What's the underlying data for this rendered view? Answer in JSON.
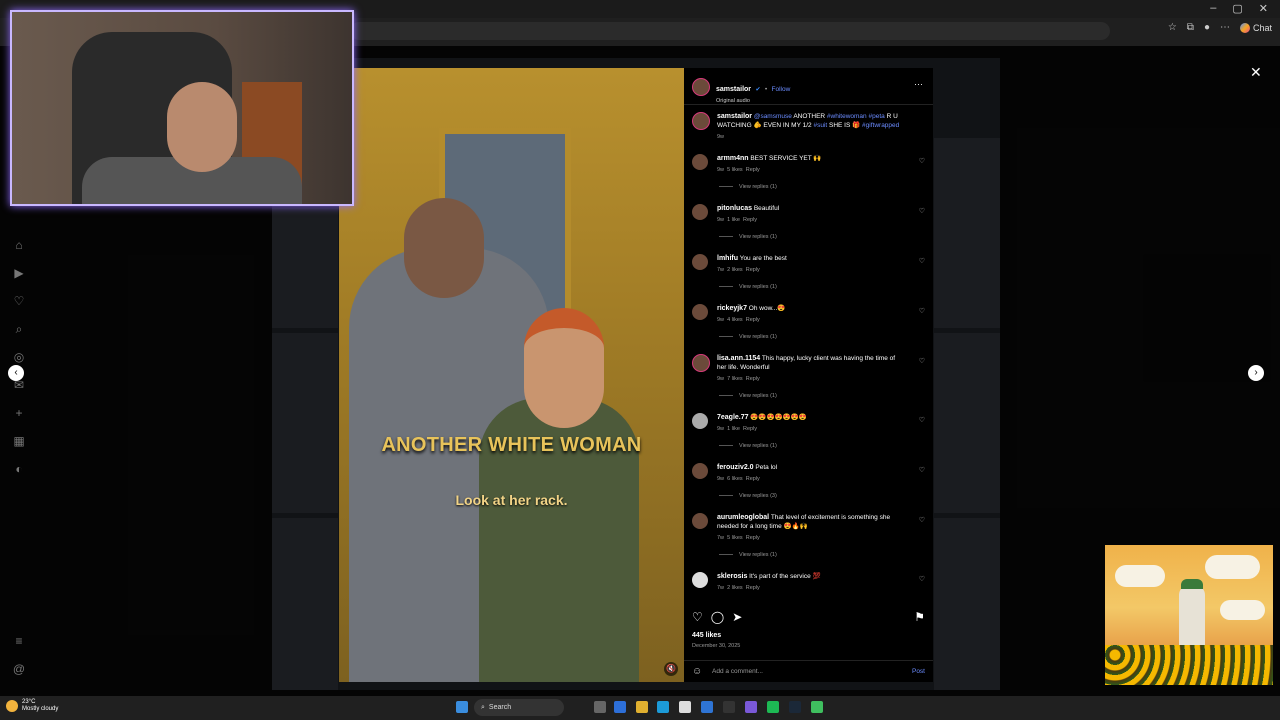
{
  "browser": {
    "chat_label": "Chat",
    "window_controls": [
      "–",
      "▢",
      "✕"
    ]
  },
  "sidebar_icons": [
    "home-icon",
    "reels-icon",
    "heart-icon",
    "search-icon",
    "explore-icon",
    "messages-icon",
    "add-icon",
    "dashboard-icon",
    "profile-icon",
    "menu-icon",
    "threads-icon"
  ],
  "video": {
    "caption_main": "ANOTHER WHITE WOMAN",
    "caption_sub": "Look at her rack."
  },
  "post": {
    "username": "samstailor",
    "follow_label": "Follow",
    "bullet": "•",
    "audio": "Original audio",
    "more_icon": "···",
    "caption": {
      "username": "samstailor",
      "mention": "@samsmuse",
      "text1": "ANOTHER",
      "tag1": "#whitewoman",
      "tag2": "#peta",
      "text2": "R U WATCHING 🫵 EVEN IN MY 1/2",
      "tag3": "#suit",
      "text3": "SHE IS 🎁",
      "tag4": "#giftwrapped",
      "time": "9w"
    },
    "comments": [
      {
        "user": "armm4nn",
        "text": "BEST SERVICE YET 🙌",
        "time": "9w",
        "likes": "5 likes",
        "reply": "Reply",
        "view": "View replies (1)"
      },
      {
        "user": "pitonlucas",
        "text": "Beautiful",
        "time": "9w",
        "likes": "1 like",
        "reply": "Reply",
        "view": "View replies (1)"
      },
      {
        "user": "lmhifu",
        "text": "You are the best",
        "time": "7w",
        "likes": "2 likes",
        "reply": "Reply",
        "view": "View replies (1)"
      },
      {
        "user": "rickeyjk7",
        "text": "Oh wow...😍",
        "time": "9w",
        "likes": "4 likes",
        "reply": "Reply",
        "view": "View replies (1)"
      },
      {
        "user": "lisa.ann.1154",
        "text": "This happy, lucky client was having the time of her life. Wonderful",
        "time": "9w",
        "likes": "7 likes",
        "reply": "Reply",
        "view": "View replies (1)"
      },
      {
        "user": "7eagle.77",
        "text": "😍😍😍😍😍😍😍",
        "time": "9w",
        "likes": "1 like",
        "reply": "Reply",
        "view": "View replies (1)"
      },
      {
        "user": "ferouziv2.0",
        "text": "Peta lol",
        "time": "9w",
        "likes": "6 likes",
        "reply": "Reply",
        "view": "View replies (3)"
      },
      {
        "user": "aurumleoglobal",
        "text": "That level of excitement is something she needed for a long time 😍🔥🙌",
        "time": "7w",
        "likes": "5 likes",
        "reply": "Reply",
        "view": "View replies (1)"
      },
      {
        "user": "sklerosis",
        "text": "It's part of the service 💯",
        "time": "7w",
        "likes": "2 likes",
        "reply": "Reply",
        "view": ""
      }
    ],
    "likes_count": "445 likes",
    "date": "December 30, 2025",
    "add_comment_placeholder": "Add a comment...",
    "post_label": "Post"
  },
  "overlay": {
    "close": "✕",
    "prev": "‹",
    "next": "›"
  },
  "taskbar": {
    "temp": "23°C",
    "weather": "Mostly cloudy",
    "search_label": "Search"
  },
  "colors": {
    "accent_link": "#6b8cff",
    "webcam_border": "#c9b8ff"
  }
}
